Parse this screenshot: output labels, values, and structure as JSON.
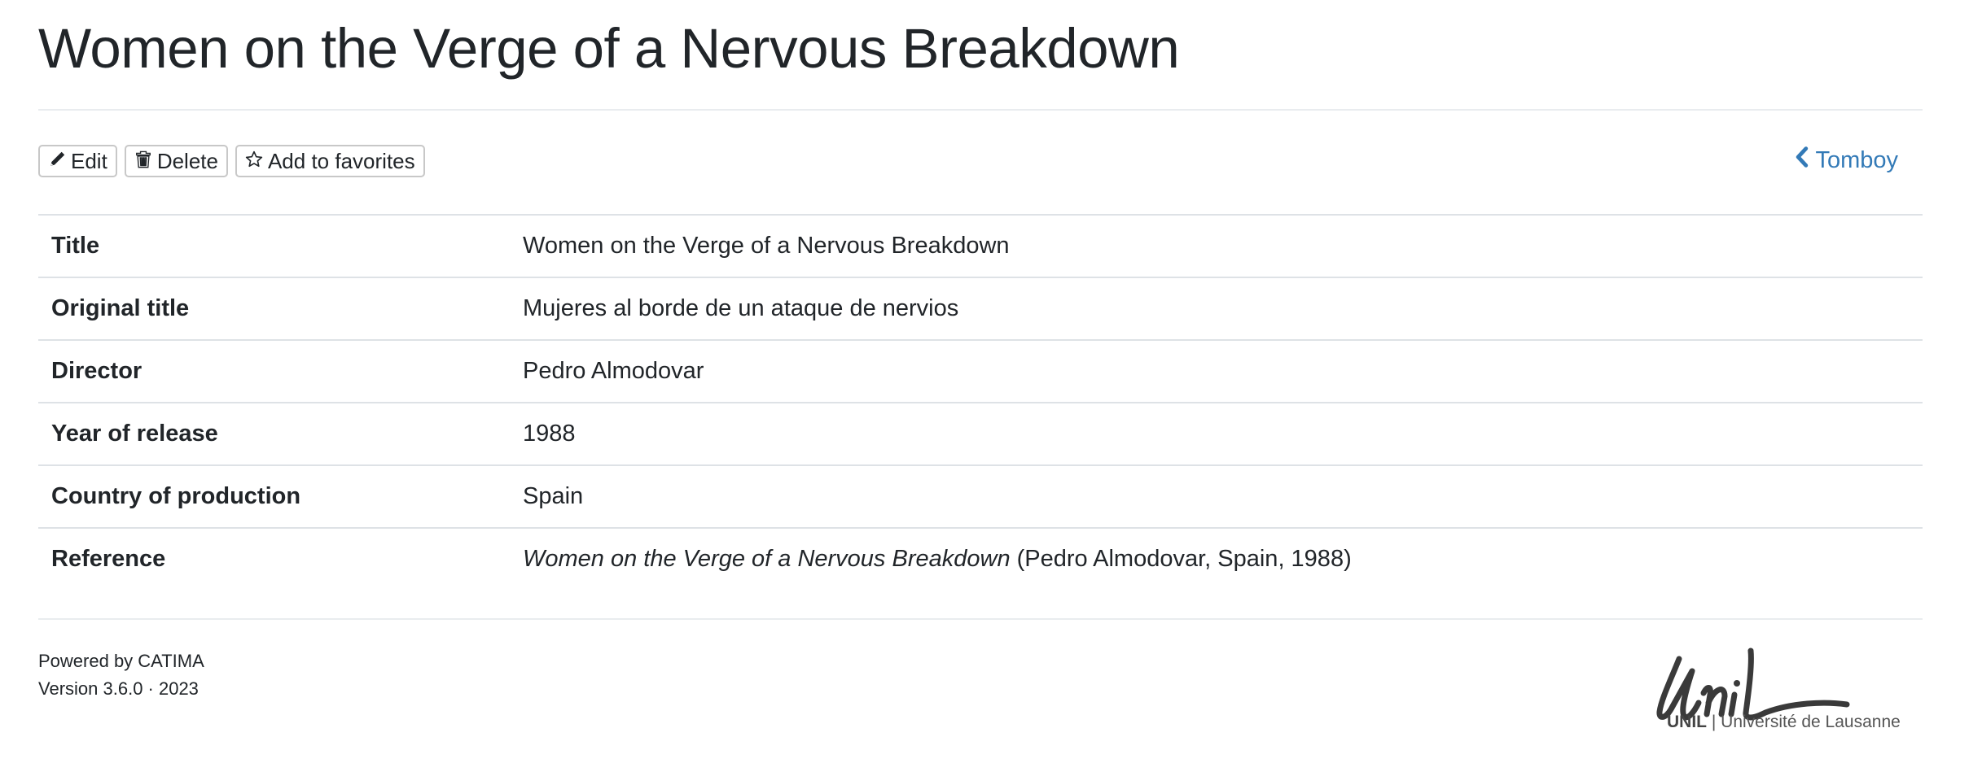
{
  "page": {
    "title": "Women on the Verge of a Nervous Breakdown"
  },
  "toolbar": {
    "edit_label": "Edit",
    "delete_label": "Delete",
    "favorites_label": "Add to favorites"
  },
  "back_link": {
    "label": "Tomboy",
    "color": "#337ab7"
  },
  "details": {
    "rows": [
      {
        "label": "Title",
        "value": "Women on the Verge of a Nervous Breakdown"
      },
      {
        "label": "Original title",
        "value": "Mujeres al borde de un ataque de nervios"
      },
      {
        "label": "Director",
        "value": "Pedro Almodovar"
      },
      {
        "label": "Year of release",
        "value": "1988"
      },
      {
        "label": "Country of production",
        "value": "Spain"
      },
      {
        "label": "Reference",
        "value_italic": "Women on the Verge of a Nervous Breakdown",
        "value_rest": "(Pedro Almodovar, Spain, 1988)"
      }
    ]
  },
  "footer": {
    "powered_by": "Powered by CATIMA",
    "version": "Version 3.6.0 · 2023"
  },
  "logo": {
    "wordmark": "Unil",
    "short_name": "UNIL",
    "separator": "|",
    "full_name": "Université de Lausanne"
  },
  "icons": {
    "edit": "pencil-icon",
    "delete": "trash-icon",
    "favorites": "star-icon",
    "back": "chevron-left-icon"
  }
}
